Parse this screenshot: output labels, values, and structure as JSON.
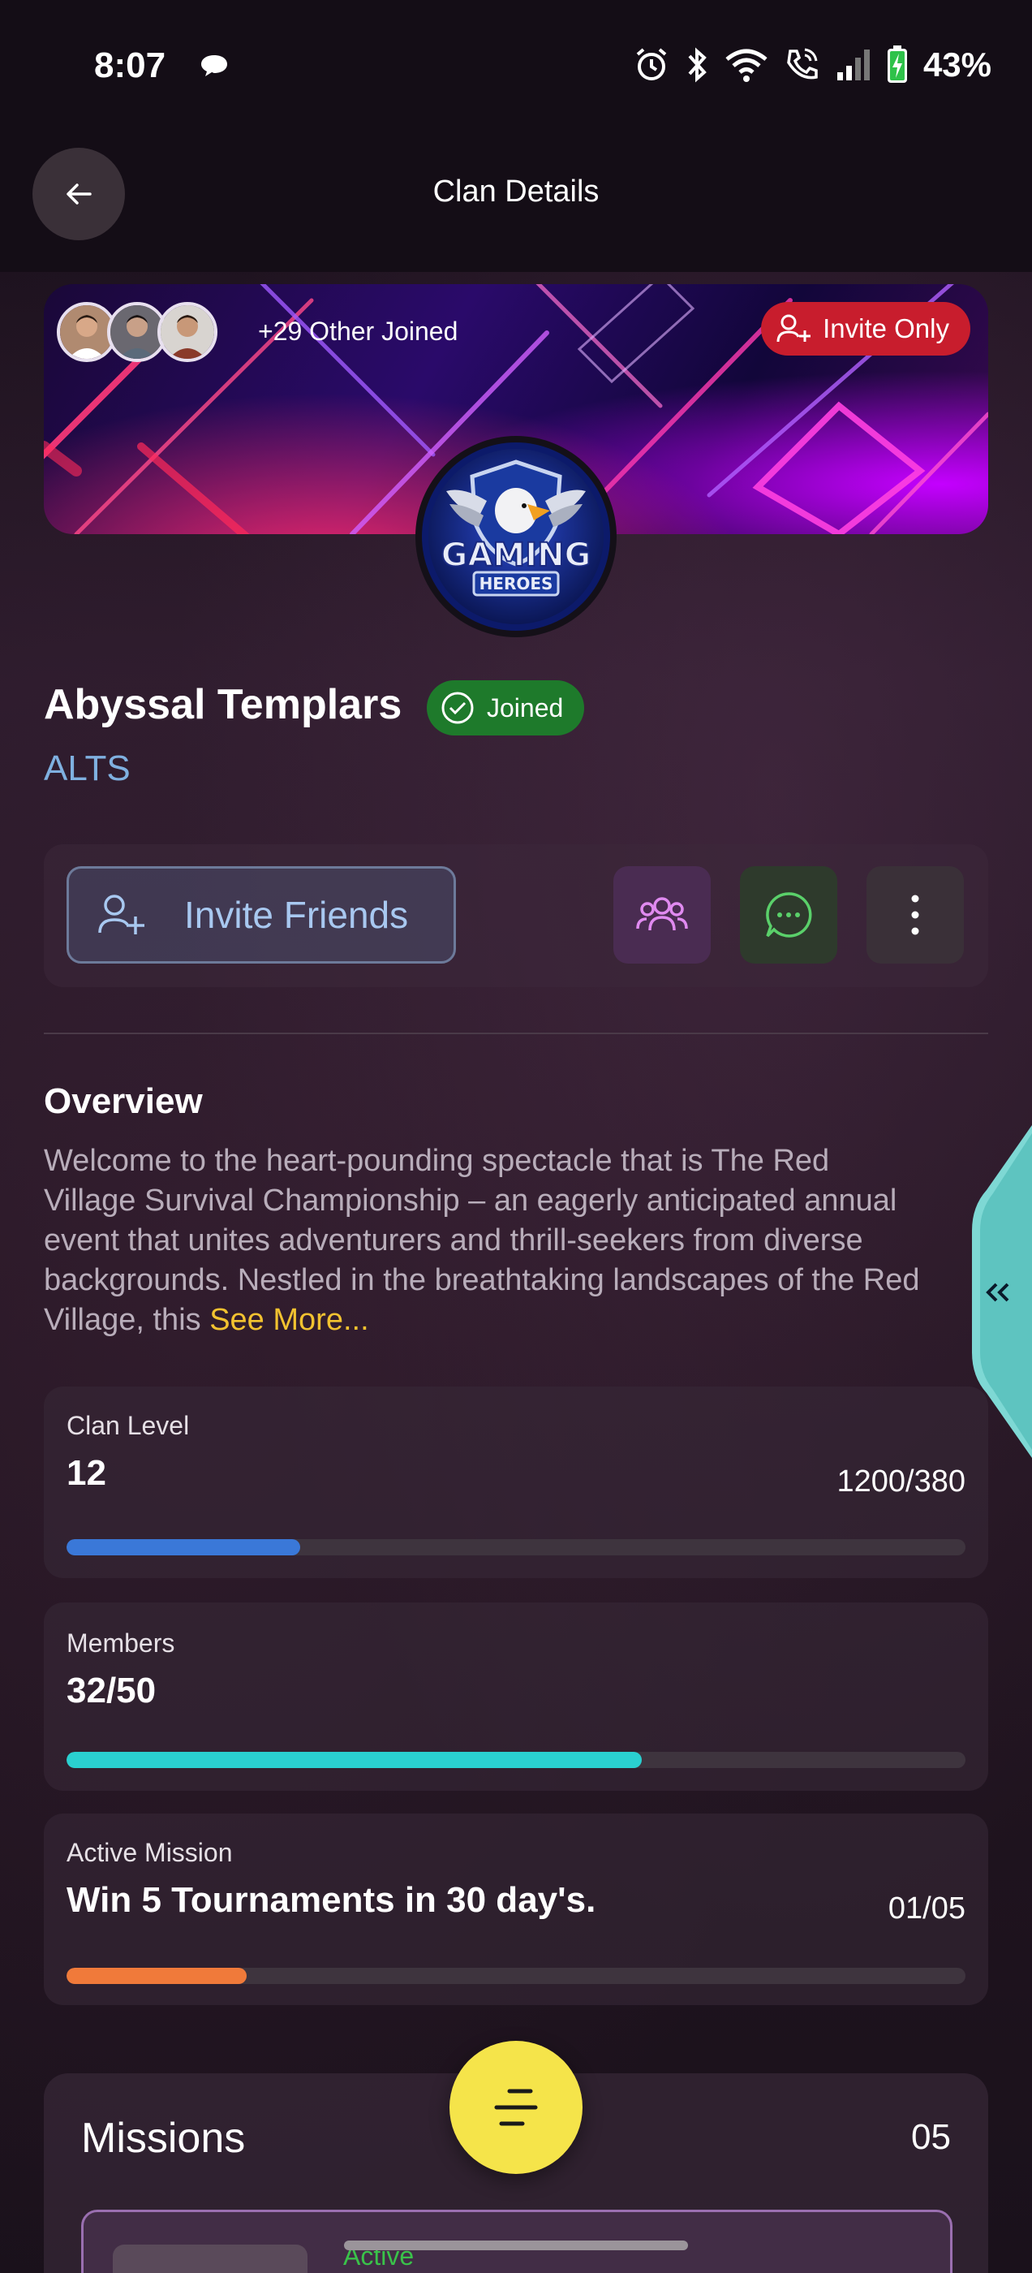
{
  "status_bar": {
    "time": "8:07",
    "battery": "43%"
  },
  "app_bar": {
    "title": "Clan Details"
  },
  "banner": {
    "joined_text": "+29 Other Joined",
    "invite_badge": "Invite Only"
  },
  "clan": {
    "name": "Abyssal Templars",
    "joined_badge": "Joined",
    "tag": "ALTS"
  },
  "actions": {
    "invite_label": "Invite Friends"
  },
  "overview": {
    "title": "Overview",
    "lines": [
      "Welcome to the heart-pounding spectacle that is The Red",
      "Village Survival Championship – an eagerly anticipated annual",
      "event that unites adventurers and thrill-seekers from diverse",
      "backgrounds. Nestled in the breathtaking landscapes of the Red",
      "Village, this "
    ],
    "see_more": "See More..."
  },
  "stats": {
    "clan_level": {
      "label": "Clan Level",
      "value": "12",
      "progress_text": "1200/380",
      "progress": 0.26,
      "color": "#3a78d8"
    },
    "members": {
      "label": "Members",
      "value": "32/50",
      "progress": 0.64,
      "color": "#2ad0d0"
    },
    "active_mission": {
      "label": "Active Mission",
      "value": "Win 5 Tournaments in 30 day's.",
      "progress_text": "01/05",
      "progress": 0.2,
      "color": "#f07a3a"
    }
  },
  "missions": {
    "title": "Missions",
    "count": "05",
    "first_status": "Active"
  },
  "colors": {
    "accent_yellow": "#f5e44a",
    "joined_green": "#1e7a2b",
    "invite_red": "#c81d2d",
    "link_blue": "#7fb0e0"
  }
}
